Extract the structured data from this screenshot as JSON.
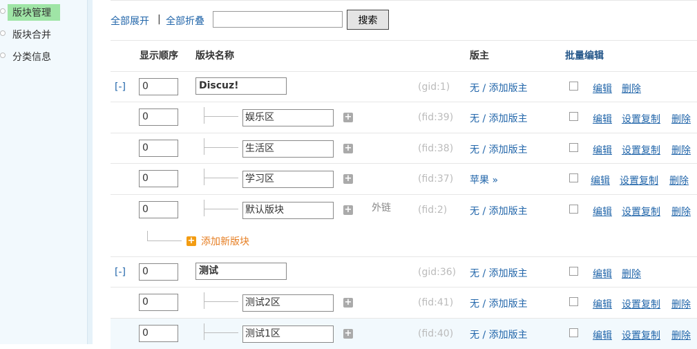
{
  "sidebar": {
    "items": [
      {
        "label": "版块管理",
        "active": true
      },
      {
        "label": "版块合并",
        "active": false
      },
      {
        "label": "分类信息",
        "active": false
      }
    ]
  },
  "toolbar": {
    "expand_all": "全部展开",
    "separator": "|",
    "collapse_all": "全部折叠",
    "search_value": "",
    "search_button": "搜索"
  },
  "headers": {
    "order": "显示顺序",
    "name": "版块名称",
    "moderator": "版主",
    "batch_edit": "批量编辑"
  },
  "rows": [
    {
      "kind": "group",
      "toggle": "[-]",
      "order": "0",
      "name": "Discuz!",
      "id": "(gid:1)",
      "mod": "无 / 添加版主",
      "actions": [
        "编辑",
        "删除"
      ]
    },
    {
      "kind": "forum",
      "order": "0",
      "name": "娱乐区",
      "id": "(fid:39)",
      "mod": "无 / 添加版主",
      "actions": [
        "编辑",
        "设置复制",
        "删除"
      ]
    },
    {
      "kind": "forum",
      "order": "0",
      "name": "生活区",
      "id": "(fid:38)",
      "mod": "无 / 添加版主",
      "actions": [
        "编辑",
        "设置复制",
        "删除"
      ]
    },
    {
      "kind": "forum",
      "order": "0",
      "name": "学习区",
      "id": "(fid:37)",
      "mod": "苹果 »",
      "actions": [
        "编辑",
        "设置复制",
        "删除"
      ]
    },
    {
      "kind": "forum",
      "order": "0",
      "name": "默认版块",
      "ext": "外链",
      "id": "(fid:2)",
      "mod": "无 / 添加版主",
      "actions": [
        "编辑",
        "设置复制",
        "删除"
      ]
    },
    {
      "kind": "group",
      "toggle": "[-]",
      "order": "0",
      "name": "测试",
      "id": "(gid:36)",
      "mod": "无 / 添加版主",
      "actions": [
        "编辑",
        "删除"
      ]
    },
    {
      "kind": "forum",
      "order": "0",
      "name": "测试2区",
      "id": "(fid:41)",
      "mod": "无 / 添加版主",
      "actions": [
        "编辑",
        "设置复制",
        "删除"
      ]
    },
    {
      "kind": "forum",
      "order": "0",
      "name": "测试1区",
      "id": "(fid:40)",
      "mod": "无 / 添加版主",
      "actions": [
        "编辑",
        "设置复制",
        "删除"
      ]
    }
  ],
  "add_forum": "添加新版块"
}
